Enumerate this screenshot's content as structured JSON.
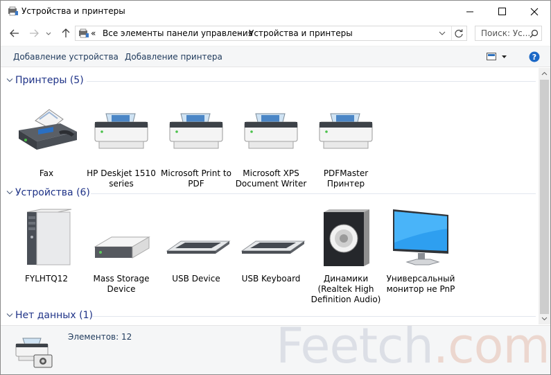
{
  "window": {
    "title": "Устройства и принтеры",
    "minimize_icon": "minimize-icon",
    "maximize_icon": "maximize-icon",
    "close_icon": "close-icon"
  },
  "nav": {
    "back_icon": "arrow-left-icon",
    "forward_icon": "arrow-right-icon",
    "recent_icon": "chevron-down-icon",
    "up_icon": "arrow-up-icon",
    "address": {
      "overflow": "«",
      "crumbs": [
        "Все элементы панели управления",
        "Устройства и принтеры"
      ],
      "separator": "›"
    },
    "search_placeholder": "Поиск: Ус..."
  },
  "toolbar": {
    "add_device": "Добавление устройства",
    "add_printer": "Добавление принтера",
    "view_icon": "view-icon",
    "help_icon": "help-icon"
  },
  "groups": {
    "printers": {
      "title": "Принтеры (5)",
      "items": [
        {
          "label": "Fax",
          "icon": "fax-icon"
        },
        {
          "label": "HP Deskjet 1510 series",
          "icon": "printer-icon"
        },
        {
          "label": "Microsoft Print to PDF",
          "icon": "printer-icon"
        },
        {
          "label": "Microsoft XPS Document Writer",
          "icon": "printer-icon"
        },
        {
          "label": "PDFMaster Принтер",
          "icon": "printer-icon"
        }
      ]
    },
    "devices": {
      "title": "Устройства (6)",
      "items": [
        {
          "label": "FYLHTQ12",
          "icon": "computer-tower-icon"
        },
        {
          "label": "Mass Storage Device",
          "icon": "storage-drive-icon"
        },
        {
          "label": "USB Device",
          "icon": "keyboard-icon"
        },
        {
          "label": "USB Keyboard",
          "icon": "keyboard-icon"
        },
        {
          "label": "Динамики (Realtek High Definition Audio)",
          "icon": "speaker-icon"
        },
        {
          "label": "Универсальный монитор не PnP",
          "icon": "monitor-icon"
        }
      ]
    },
    "nodata": {
      "title": "Нет данных (1)"
    }
  },
  "details": {
    "count": "Элементов: 12",
    "icon": "devices-printers-icon"
  },
  "watermark": {
    "part1": "Feetch",
    "part2": ".com"
  }
}
